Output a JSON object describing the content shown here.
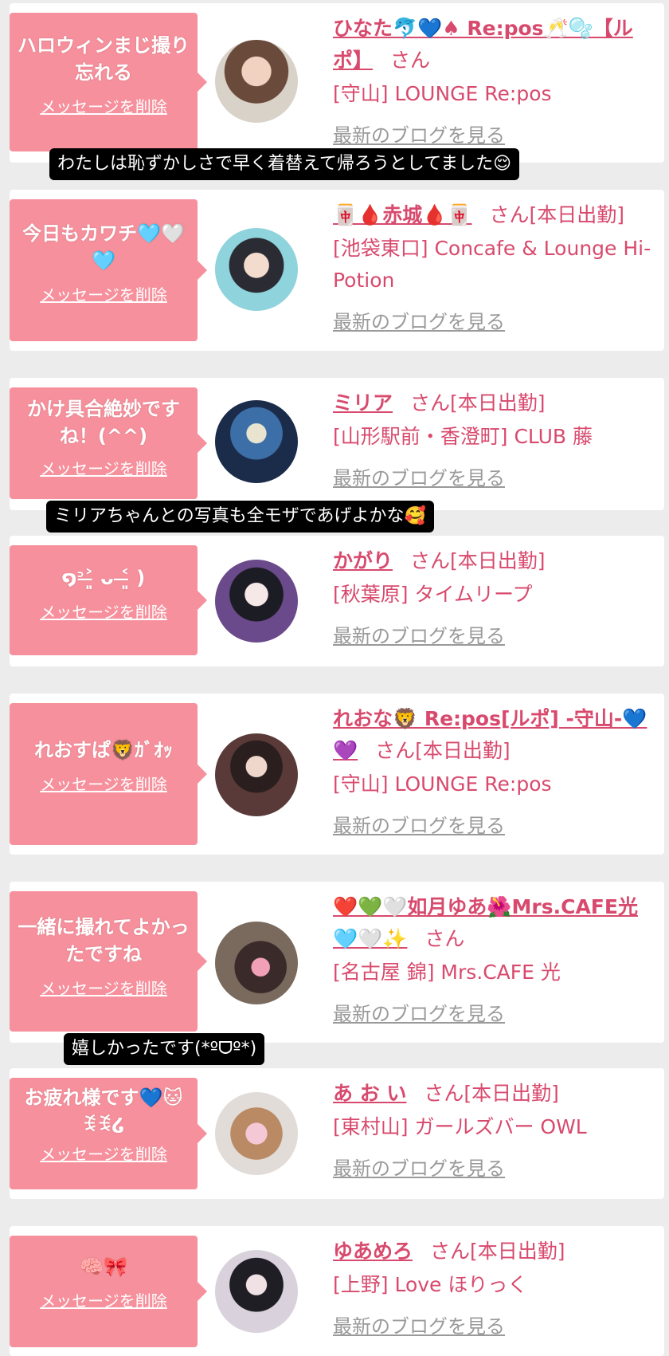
{
  "delete_label": "メッセージを削除",
  "blog_label": "最新のブログを見る",
  "cards": [
    {
      "message": "ハロウィンまじ撮り忘れる",
      "name": "ひなた🐬💙♠ Re:pos🥂🫧【ルポ】",
      "honorific": "さん",
      "shop": "[守山] LOUNGE Re:pos"
    },
    {
      "message": "今日もカワチ🩵🤍🩵",
      "name": "🀄🩸赤城🩸🀄",
      "honorific": "さん[本日出勤]",
      "shop": "[池袋東口] Concafe & Lounge Hi-Potion"
    },
    {
      "message": "かけ具合絶妙ですね！(^^)",
      "name": "ミリア",
      "honorific": "さん[本日出勤]",
      "shop": "[山形駅前・香澄町] CLUB 藤"
    },
    {
      "message": "໑ᐣ˃̶͈ ᴗ ˂̶͈ )",
      "name": "かがり",
      "honorific": "さん[本日出勤]",
      "shop": "[秋葉原] タイムリープ"
    },
    {
      "message": "れおすぱ🦁ｶﾞｵｯ",
      "name": "れおな🦁 Re:pos[ルポ] -守山-💙💜",
      "honorific": "さん[本日出勤]",
      "shop": "[守山] LOUNGE Re:pos"
    },
    {
      "message": "一緒に撮れてよかったですね",
      "name": "❤️💚🤍如月ゆあ🌺Mrs.CAFE光🩵🤍✨",
      "honorific": "さん",
      "shop": "[名古屋 錦] Mrs.CAFE 光"
    },
    {
      "message": "お疲れ様です💙🐱ꉂꉂ໒",
      "name": "あ お い",
      "honorific": "さん[本日出勤]",
      "shop": "[東村山] ガールズバー OWL"
    },
    {
      "message": "🧠🎀",
      "name": "ゆあめろ",
      "honorific": "さん[本日出勤]",
      "shop": "[上野] Love ほりっく"
    }
  ],
  "captions": [
    "わたしは恥ずかしさで早く着替えて帰ろうとしてました😌",
    "ミリアちゃんとの写真も全モザであげよかな🥰",
    "嬉しかったです(*ºᗜº*)"
  ],
  "colors": {
    "accent": "#d84a6d",
    "bubble": "#f6909c",
    "muted": "#9a9a9a"
  }
}
